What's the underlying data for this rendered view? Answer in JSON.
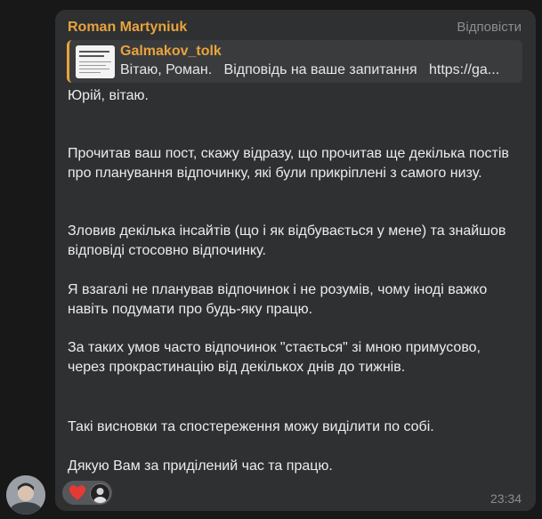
{
  "message": {
    "author": "Roman Martyniuk",
    "reply_action": "Відповісти",
    "quote": {
      "name": "Galmakov_tolk",
      "text": "Вітаю, Роман.   Відповідь на ваше запитання   https://ga..."
    },
    "paragraphs": [
      "Юрій, вітаю.",
      "Прочитав ваш пост, скажу відразу, що прочитав ще декілька постів про планування відпочинку, які були прикріплені з самого низу.",
      "Зловив декілька інсайтів (що і як відбувається у мене) та знайшов відповіді стосовно відпочинку.",
      "Я взагалі не планував відпочинок і не розумів, чому іноді важко навіть подумати про будь-яку працю.",
      "За таких умов часто відпочинок \"стається\" зі мною примусово, через прокрастинацію від декількох днів до тижнів.",
      "Такі висновки та спостереження можу виділити по собі.",
      "Дякую Вам за приділений час та працю."
    ],
    "time": "23:34",
    "reaction": {
      "icon": "heart-icon",
      "color": "#e53935"
    }
  },
  "colors": {
    "background": "#181818",
    "bubble": "#2f3031",
    "accent": "#e8a33d",
    "text": "#ececec",
    "muted": "#8b8d90"
  }
}
